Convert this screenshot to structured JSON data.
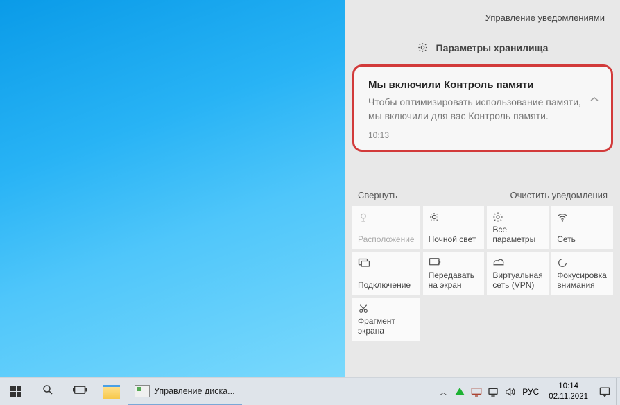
{
  "action_center": {
    "manage_link": "Управление уведомлениями",
    "group_header": "Параметры хранилища",
    "notification": {
      "title": "Мы включили Контроль памяти",
      "body": "Чтобы оптимизировать использование памяти, мы включили для вас Контроль памяти.",
      "time": "10:13"
    },
    "collapse": "Свернуть",
    "clear": "Очистить уведомления",
    "tiles": [
      {
        "icon": "location-icon",
        "label": "Расположение",
        "disabled": true
      },
      {
        "icon": "moon-icon",
        "label": "Ночной свет",
        "disabled": false
      },
      {
        "icon": "settings-gear-icon",
        "label": "Все параметры",
        "disabled": false
      },
      {
        "icon": "wifi-icon",
        "label": "Сеть",
        "disabled": false
      },
      {
        "icon": "connect-icon",
        "label": "Подключение",
        "disabled": false
      },
      {
        "icon": "project-icon",
        "label": "Передавать на экран",
        "disabled": false
      },
      {
        "icon": "vpn-icon",
        "label": "Виртуальная сеть (VPN)",
        "disabled": false
      },
      {
        "icon": "focus-icon",
        "label": "Фокусировка внимания",
        "disabled": false
      },
      {
        "icon": "snip-icon",
        "label": "Фрагмент экрана",
        "disabled": false
      }
    ]
  },
  "taskbar": {
    "app_task_label": "Управление диска...",
    "lang": "РУС",
    "clock_time": "10:14",
    "clock_date": "02.11.2021"
  }
}
